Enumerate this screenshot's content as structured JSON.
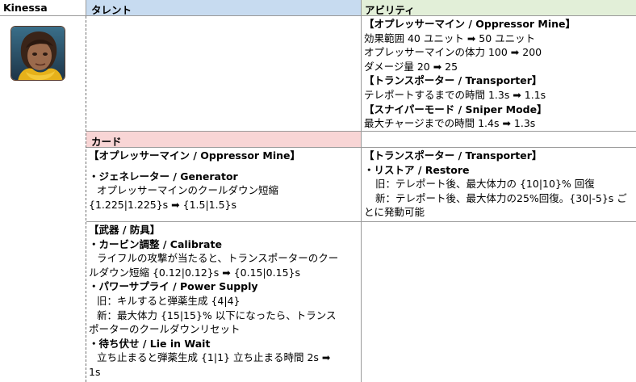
{
  "header": {
    "name": "Kinessa",
    "talent": "タレント",
    "ability": "アビリティ"
  },
  "ability": {
    "lines": [
      "【オプレッサーマイン / Oppressor Mine】",
      "効果範囲 40 ユニット ➡ 50 ユニット",
      "オプレッサーマインの体力 100 ➡ 200",
      "ダメージ量 20 ➡ 25",
      "【トランスポーター / Transporter】",
      "テレポートするまでの時間 1.3s ➡ 1.1s",
      "【スナイパーモード / Sniper Mode】",
      "最大チャージまでの時間 1.4s ➡ 1.3s"
    ]
  },
  "card": {
    "header": "カード",
    "left": {
      "title": "【オプレッサーマイン / Oppressor Mine】",
      "item_name": "・ジェネレーター / Generator",
      "desc1": "オプレッサーマインのクールダウン短縮",
      "desc2": "{1.225|1.225}s ➡ {1.5|1.5}s"
    },
    "right": {
      "title": "【トランスポーター / Transporter】",
      "item_name": "・リストア / Restore",
      "old": "旧：テレポート後、最大体力の {10|10}% 回復",
      "new1": "新：テレポート後、最大体力の25%回復。{30|-5}s ご",
      "new2": "とに発動可能"
    }
  },
  "weapon": {
    "title": "【武器 / 防具】",
    "items": [
      {
        "name": "・カービン調整 / Calibrate",
        "l1": "ライフルの攻撃が当たると、トランスポーターのクー",
        "l2": "ルダウン短縮 {0.12|0.12}s ➡ {0.15|0.15}s"
      },
      {
        "name": "・パワーサプライ / Power Supply",
        "l1": "旧：キルすると弾薬生成 {4|4}",
        "l2": "新：最大体力 {15|15}% 以下になったら、トランス",
        "l3": "ポーターのクールダウンリセット"
      },
      {
        "name": "・待ち伏せ / Lie in Wait",
        "l1": "立ち止まると弾薬生成 {1|1} 立ち止まる時間 2s ➡",
        "l2": "1s"
      }
    ]
  }
}
